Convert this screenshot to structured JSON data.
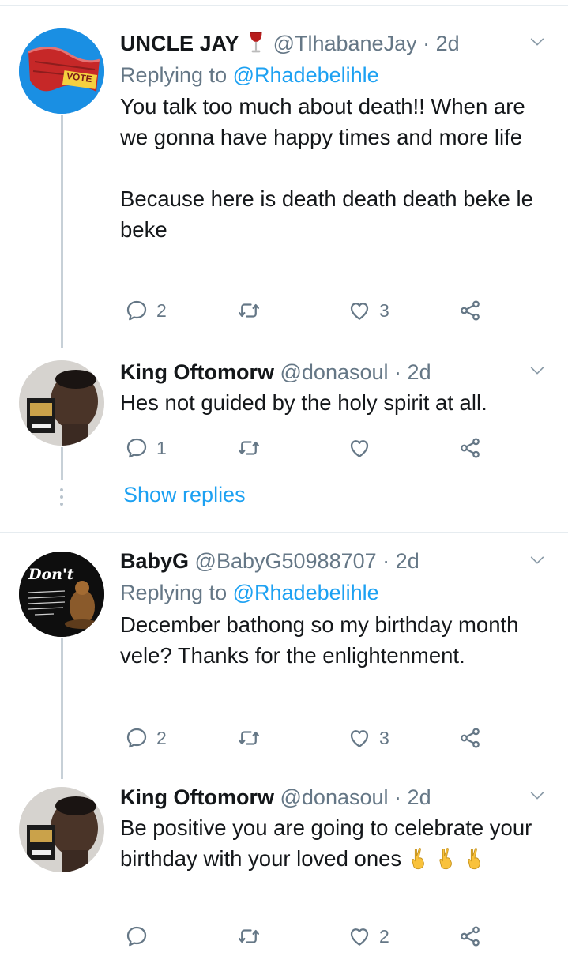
{
  "tweets": [
    {
      "name": "UNCLE JAY",
      "name_emoji": "wine-glass-emoji",
      "handle": "@TlhabaneJay",
      "time": "2d",
      "replying_label": "Replying to",
      "replying_to": "@Rhadebelihle",
      "text": "You talk too much about death!! When are we gonna have happy times and more life\n\nBecause here is death death death beke le beke",
      "replies": "2",
      "likes": "3",
      "avatar_text": "VOTE"
    },
    {
      "name": "King Oftomorw",
      "handle": "@donasoul",
      "time": "2d",
      "text": "Hes not guided by the holy spirit at all.",
      "replies": "1",
      "likes": ""
    },
    {
      "name": "BabyG",
      "handle": "@BabyG50988707",
      "time": "2d",
      "replying_label": "Replying to",
      "replying_to": "@Rhadebelihle",
      "text": "December bathong so my birthday month vele? Thanks for the enlightenment.",
      "replies": "2",
      "likes": "3",
      "avatar_text": "Don't"
    },
    {
      "name": "King Oftomorw",
      "handle": "@donasoul",
      "time": "2d",
      "text": "Be positive you are going to celebrate your birthday with your loved ones",
      "text_emoji": "crossed-fingers-emoji",
      "replies": "",
      "likes": "2"
    }
  ],
  "show_replies_label": "Show replies",
  "dot_separator": "·",
  "colors": {
    "link": "#1da1f2",
    "secondary_text": "#657786",
    "thread_line": "#c7d0d7",
    "divider": "#e6ecf0"
  }
}
